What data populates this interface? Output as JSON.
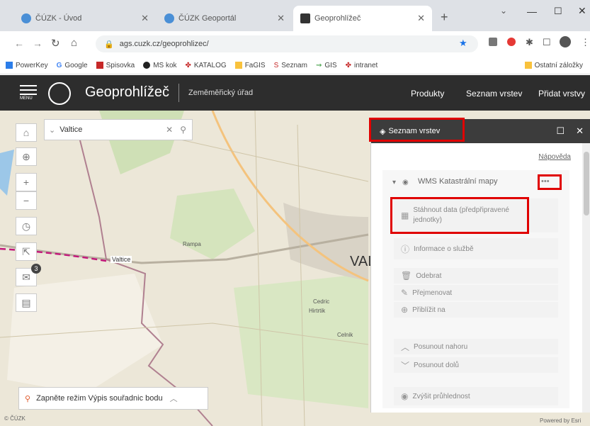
{
  "browser": {
    "tabs": [
      {
        "title": "ČÚZK - Úvod",
        "active": false
      },
      {
        "title": "ČÚZK Geoportál",
        "active": false
      },
      {
        "title": "Geoprohlížeč",
        "active": true
      }
    ],
    "new_tab": "+",
    "url": "ags.cuzk.cz/geoprohlizec/",
    "bookmarks": [
      "PowerKey",
      "Google",
      "Spisovka",
      "MS kok",
      "KATALOG",
      "FaGIS",
      "Seznam",
      "GIS",
      "intranet"
    ],
    "other_bookmarks": "Ostatní záložky"
  },
  "app": {
    "title": "Geoprohlížeč",
    "subtitle": "Zeměměřický úřad",
    "menu_label": "MENU",
    "nav": [
      "Produkty",
      "Seznam vrstev",
      "Přidat vrstvy"
    ]
  },
  "map": {
    "search_value": "Valtice",
    "coord_mode_text": "Zapněte režim Výpis souřadnic bodu",
    "footer_left": "© ČÚZK",
    "footer_right": "Powered by Esri",
    "badge_count": "3",
    "place_labels": [
      "Valtice",
      "VAL",
      "Rampa",
      "Cedric",
      "Hirtrtik",
      "Celnik"
    ]
  },
  "panel": {
    "title": "Seznam vrstev",
    "help_link": "Nápověda",
    "layer_name": "WMS Katastrální mapy",
    "more": "•••",
    "menu_items": [
      "Stáhnout data (předpřipravené jednotky)",
      "Informace o službě",
      "Odebrat",
      "Přejmenovat",
      "Přiblížit na",
      "Posunout nahoru",
      "Posunout dolů",
      "Zvýšit průhlednost"
    ]
  },
  "colors": {
    "header_bg": "#2d2d2d",
    "highlight": "#e00000",
    "panel_head": "#3c3c3c"
  }
}
